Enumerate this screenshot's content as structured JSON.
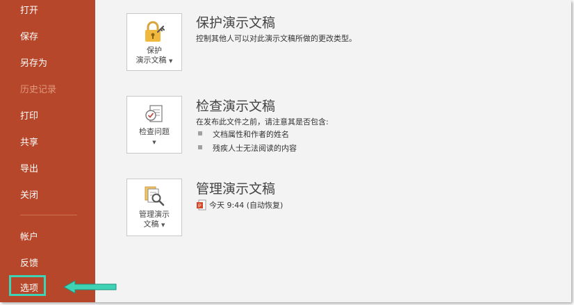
{
  "sidebar": {
    "items": [
      {
        "label": "打开",
        "enabled": true
      },
      {
        "label": "保存",
        "enabled": true
      },
      {
        "label": "另存为",
        "enabled": true
      },
      {
        "label": "历史记录",
        "enabled": false
      },
      {
        "label": "打印",
        "enabled": true
      },
      {
        "label": "共享",
        "enabled": true
      },
      {
        "label": "导出",
        "enabled": true
      },
      {
        "label": "关闭",
        "enabled": true
      }
    ],
    "bottom_items": [
      {
        "label": "帐户"
      },
      {
        "label": "反馈"
      },
      {
        "label": "选项",
        "highlighted": true
      }
    ],
    "colors": {
      "background": "#b7472a",
      "highlight": "#3fd3b5"
    }
  },
  "sections": {
    "protect": {
      "tile_label_line1": "保护",
      "tile_label_line2": "演示文稿",
      "title": "保护演示文稿",
      "description": "控制其他人可以对此演示文稿所做的更改类型。",
      "icon": "lock-key-icon"
    },
    "inspect": {
      "tile_label": "检查问题",
      "title": "检查演示文稿",
      "description": "在发布此文件之前，请注意其是否包含:",
      "bullets": [
        "文档属性和作者的姓名",
        "残疾人士无法阅读的内容"
      ],
      "icon": "checklist-icon"
    },
    "manage": {
      "tile_label_line1": "管理演示",
      "tile_label_line2": "文稿",
      "title": "管理演示文稿",
      "version_text": "今天 9:44 (自动恢复)",
      "icon": "document-search-icon",
      "file_icon": "powerpoint-file-icon"
    }
  }
}
